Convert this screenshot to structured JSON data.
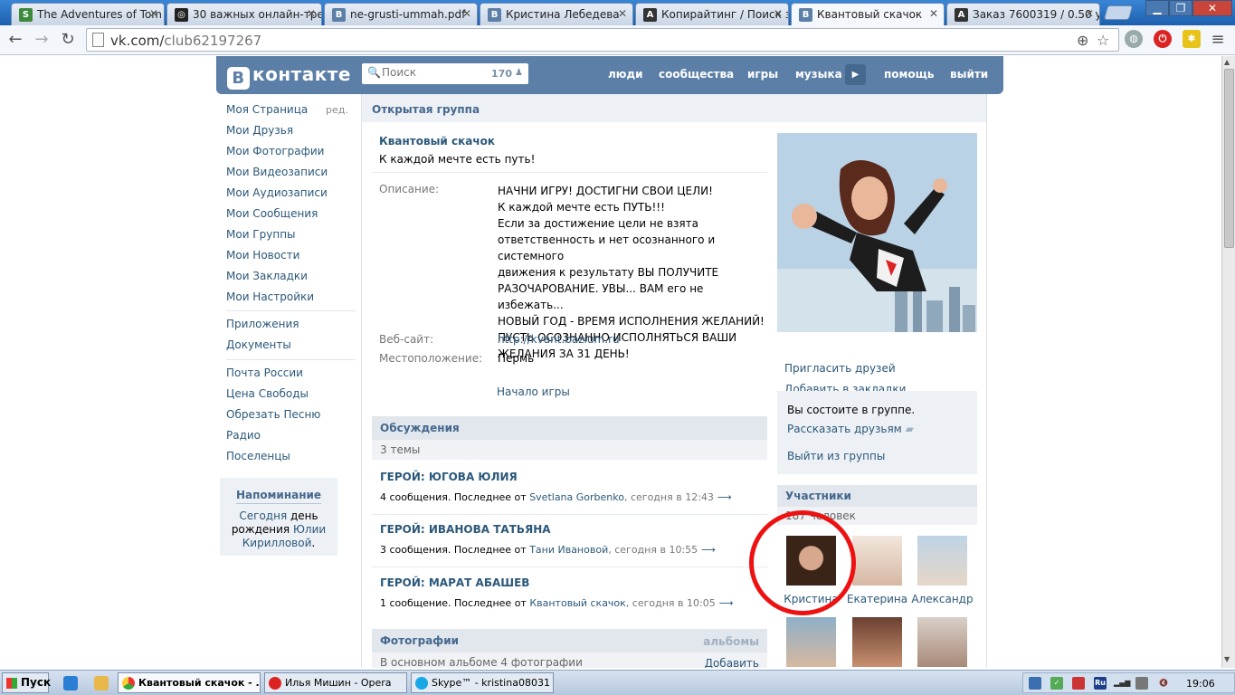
{
  "browser": {
    "tabs": [
      {
        "title": "The Adventures of Tom",
        "icon": "s-icon",
        "color": "#3c8a3c"
      },
      {
        "title": "30 важных онлайн-тре",
        "icon": "globe-icon",
        "color": "#222222"
      },
      {
        "title": "ne-grusti-ummah.pdf",
        "icon": "vk-icon",
        "color": "#5b7fa6"
      },
      {
        "title": "Кристина Лебедева",
        "icon": "vk-icon",
        "color": "#5b7fa6"
      },
      {
        "title": "Копирайтинг / Поиск за",
        "icon": "a-icon",
        "color": "#333333"
      },
      {
        "title": "Квантовый скачок",
        "icon": "vk-icon",
        "color": "#5b7fa6",
        "active": true
      },
      {
        "title": "Заказ 7600319 / 0.50 у.",
        "icon": "a-icon",
        "color": "#333333"
      }
    ],
    "url_host": "vk.com/",
    "url_path": "club62197267"
  },
  "vk": {
    "logo": "контакте",
    "logo_letter": "В",
    "search_placeholder": "Поиск",
    "search_count": "170",
    "nav": [
      "люди",
      "сообщества",
      "игры",
      "музыка",
      "помощь",
      "выйти"
    ]
  },
  "left_menu": {
    "items": [
      "Моя Страница",
      "Мои Друзья",
      "Мои Фотографии",
      "Мои Видеозаписи",
      "Мои Аудиозаписи",
      "Мои Сообщения",
      "Мои Группы",
      "Мои Новости",
      "Мои Закладки",
      "Мои Настройки"
    ],
    "edit": "ред.",
    "apps": [
      "Приложения",
      "Документы"
    ],
    "extra": [
      "Почта России",
      "Цена Свободы",
      "Обрезать Песню",
      "Радио",
      "Поселенцы"
    ],
    "reminder": {
      "title": "Напоминание",
      "w1": "Сегодня",
      "w2": " день рождения ",
      "w3": "Юлии Кирилловой",
      "w4": "."
    }
  },
  "group": {
    "type": "Открытая группа",
    "name": "Квантовый скачок",
    "status": "К каждой мечте есть путь!",
    "desc_label": "Описание:",
    "desc_lines": [
      "НАЧНИ ИГРУ! ДОСТИГНИ СВОИ ЦЕЛИ!",
      "К каждой мечте есть ПУТЬ!!!",
      "Если за достижение цели не взята",
      "ответственность и нет осознанного и системного",
      "движения к результату ВЫ ПОЛУЧИТЕ",
      "РАЗОЧАРОВАНИЕ. УВЫ... ВАМ его не избежать...",
      "НОВЫЙ ГОД - ВРЕМЯ ИСПОЛНЕНИЯ ЖЕЛАНИЙ!",
      "ПУСТЬ ОСОЗНАННО ИСПОЛНЯТЬСЯ ВАШИ",
      "ЖЕЛАНИЯ ЗА 31 ДЕНЬ!"
    ],
    "site_label": "Веб-сайт:",
    "site": "http://kvant.bazium.ru",
    "location_label": "Местоположение:",
    "location": "Пермь",
    "start_game": "Начало игры"
  },
  "discussions": {
    "title": "Обсуждения",
    "count": "3 темы",
    "topics": [
      {
        "title": "ГЕРОЙ: ЮГОВА ЮЛИЯ",
        "count": "4 сообщения. Последнее от ",
        "author": "Svetlana Gorbenko",
        "time": ", сегодня в 12:43"
      },
      {
        "title": "ГЕРОЙ: ИВАНОВА ТАТЬЯНА",
        "count": "3 сообщения. Последнее от ",
        "author": "Тани Ивановой",
        "time": ", сегодня в 10:55"
      },
      {
        "title": "ГЕРОЙ: МАРАТ АБАШЕВ",
        "count": "1 сообщение. Последнее от ",
        "author": "Квантовый скачок",
        "time": ", сегодня в 10:05"
      }
    ]
  },
  "photos": {
    "title": "Фотографии",
    "albums": "альбомы",
    "sub": "В основном альбоме 4 фотографии",
    "add": "Добавить"
  },
  "side": {
    "invite": "Пригласить друзей",
    "bookmark": "Добавить в закладки",
    "member_status": "Вы состоите в группе.",
    "tell": "Рассказать друзьям",
    "leave": "Выйти из группы",
    "members_title": "Участники",
    "members_count": "187 человек",
    "members": [
      "Кристина",
      "Екатерина",
      "Александр"
    ]
  },
  "taskbar": {
    "start": "Пуск",
    "windows": [
      "Квантовый скачок - ...",
      "Илья Мишин - Opera",
      "Skype™ - kristina08031"
    ],
    "lang": "Ru",
    "clock": "19:06"
  }
}
